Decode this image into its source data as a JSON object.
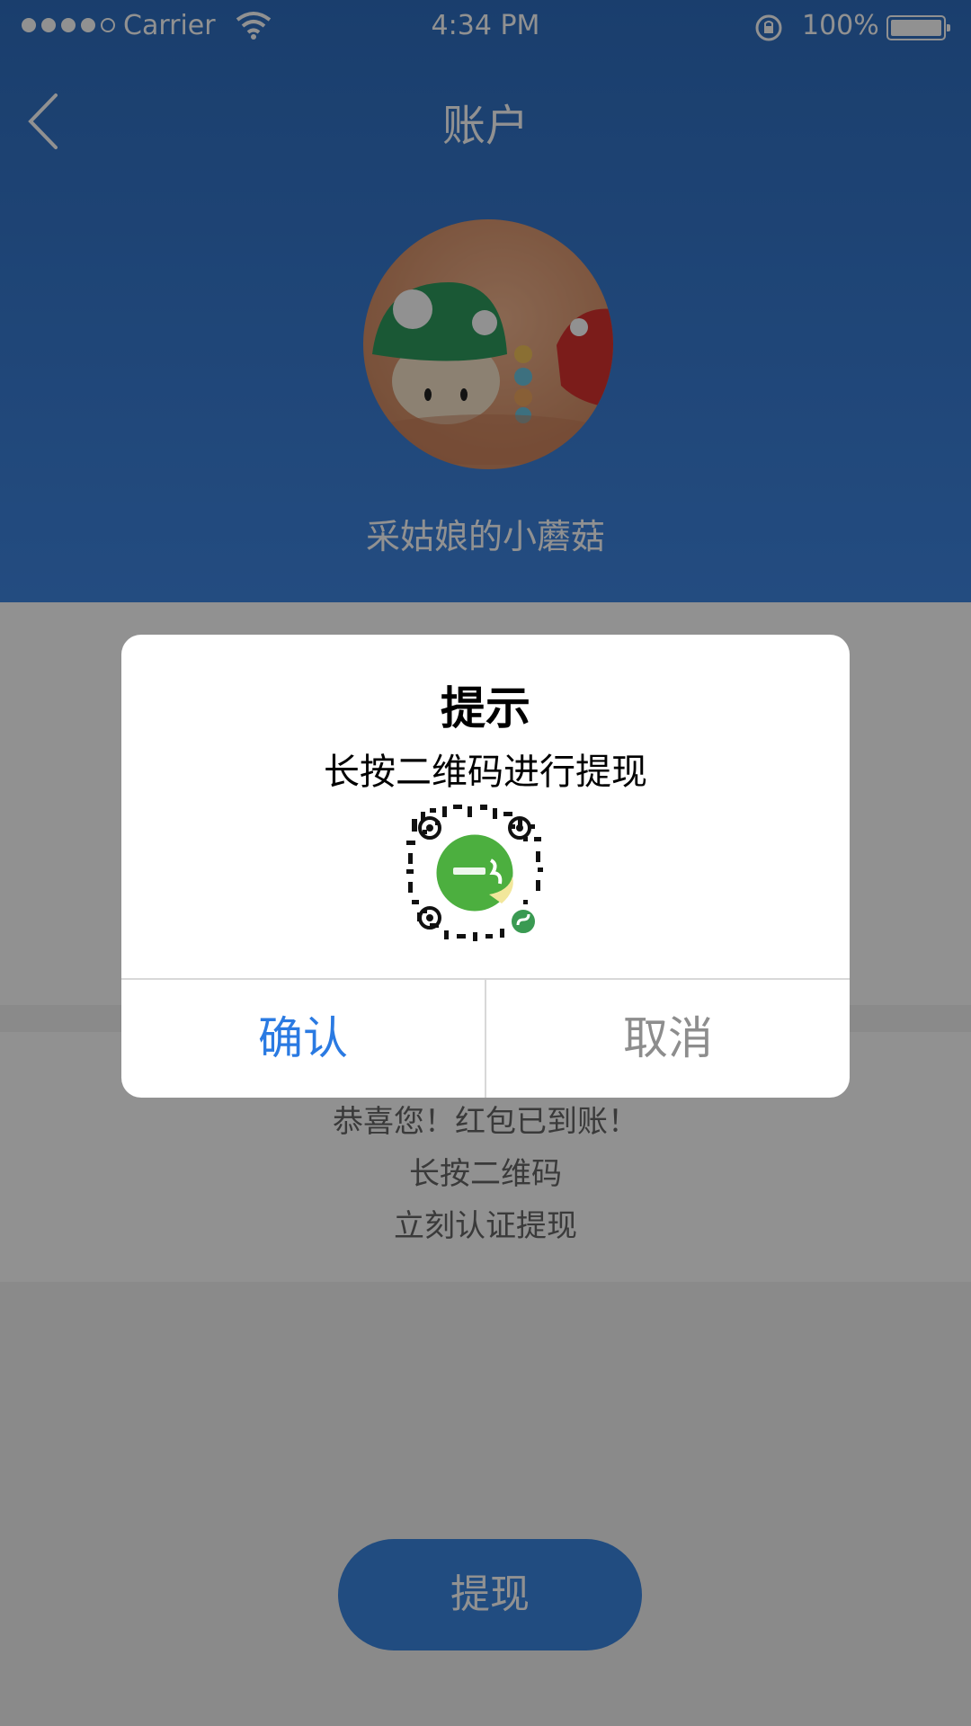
{
  "status_bar": {
    "carrier": "Carrier",
    "time": "4:34 PM",
    "battery": "100%"
  },
  "nav": {
    "title": "账户",
    "back_icon": "chevron-left-icon"
  },
  "profile": {
    "avatar": "mushroom-avatar",
    "username": "采姑娘的小蘑菇"
  },
  "notice": {
    "lines": [
      "恭喜您！红包已到账！",
      "长按二维码",
      "立刻认证提现"
    ]
  },
  "actions": {
    "withdraw_label": "提现"
  },
  "dialog": {
    "title": "提示",
    "message": "长按二维码进行提现",
    "qr_icon": "mini-program-qr-code",
    "confirm_label": "确认",
    "cancel_label": "取消"
  },
  "colors": {
    "header_blue": "#3f86e2",
    "confirm_blue": "#2a7ae2",
    "cancel_gray": "#8d8d8d"
  }
}
